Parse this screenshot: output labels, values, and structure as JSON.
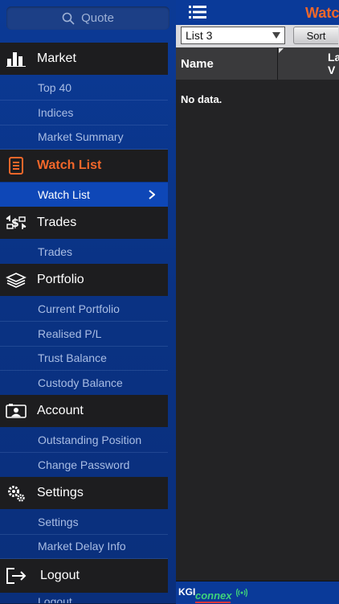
{
  "sidebar": {
    "search_placeholder": "Quote",
    "sections": [
      {
        "key": "market",
        "label": "Market",
        "icon": "bar-chart-icon",
        "items": [
          "Top 40",
          "Indices",
          "Market Summary"
        ]
      },
      {
        "key": "watchlist",
        "label": "Watch List",
        "icon": "document-list-icon",
        "items": [
          "Watch List"
        ]
      },
      {
        "key": "trades",
        "label": "Trades",
        "icon": "money-transfer-icon",
        "items": [
          "Trades"
        ]
      },
      {
        "key": "portfolio",
        "label": "Portfolio",
        "icon": "layers-icon",
        "items": [
          "Current Portfolio",
          "Realised P/L",
          "Trust Balance",
          "Custody Balance"
        ]
      },
      {
        "key": "account",
        "label": "Account",
        "icon": "id-card-icon",
        "items": [
          "Outstanding Position",
          "Change Password"
        ]
      },
      {
        "key": "settings",
        "label": "Settings",
        "icon": "gears-icon",
        "items": [
          "Settings",
          "Market Delay Info"
        ]
      },
      {
        "key": "logout",
        "label": "Logout",
        "icon": "logout-icon",
        "items": [
          "Logout"
        ]
      }
    ],
    "active_section": "Watch List",
    "selected_item": "Watch List"
  },
  "main": {
    "title": "Watc",
    "list_select_value": "List 3",
    "sort_label": "Sort",
    "columns": {
      "name": "Name",
      "last_line1": "La",
      "last_line2": "V"
    },
    "empty_message": "No data."
  },
  "footer": {
    "brand_kgi": "KGI",
    "brand_connex": "connex"
  },
  "colors": {
    "accent": "#f2672a",
    "sidebar_bg": "#0a3283",
    "section_bg": "#1d1d1f",
    "panel_bg": "#232325"
  }
}
